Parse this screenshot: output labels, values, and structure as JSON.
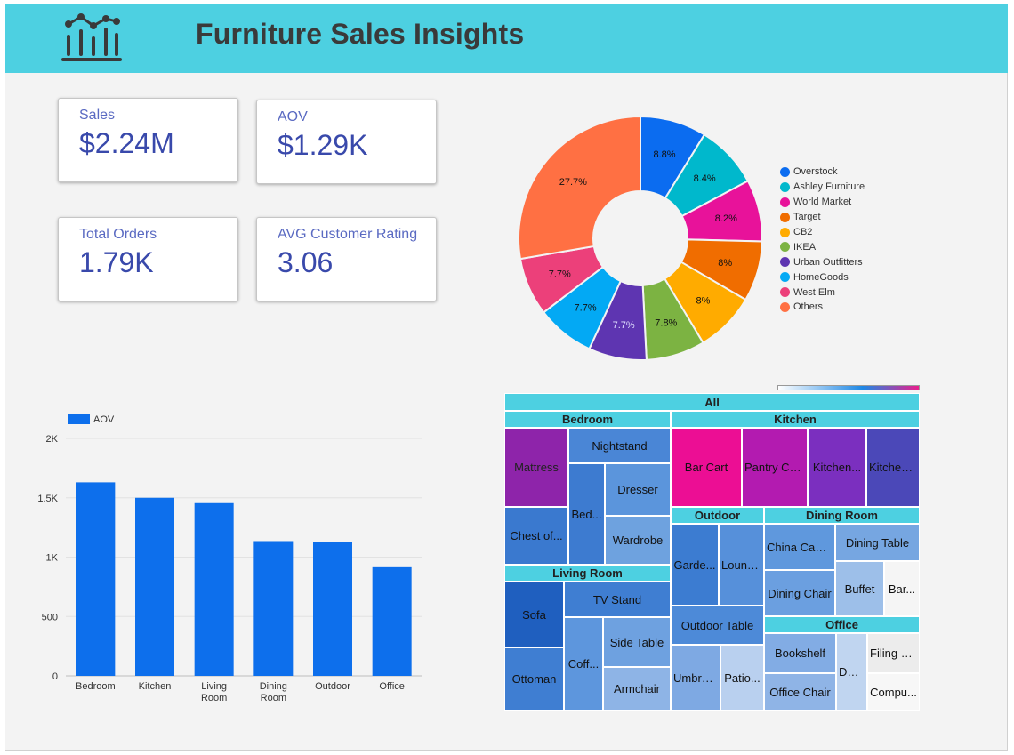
{
  "header": {
    "title": "Furniture Sales Insights",
    "logo_icon": "bar-chart-logo-icon"
  },
  "kpis": {
    "sales": {
      "label": "Sales",
      "value": "$2.24M"
    },
    "aov": {
      "label": "AOV",
      "value": "$1.29K"
    },
    "total_orders": {
      "label": "Total Orders",
      "value": "1.79K"
    },
    "avg_rating": {
      "label": "AVG Customer Rating",
      "value": "3.06"
    }
  },
  "chart_data": [
    {
      "type": "pie",
      "subtype": "donut",
      "legend_position": "right",
      "slices": [
        {
          "name": "Overstock",
          "value": 8.8,
          "label": "8.8%",
          "color": "#0b6cf0"
        },
        {
          "name": "Ashley Furniture",
          "value": 8.4,
          "label": "8.4%",
          "color": "#00b8cc"
        },
        {
          "name": "World Market",
          "value": 8.2,
          "label": "8.2%",
          "color": "#e8129a"
        },
        {
          "name": "Target",
          "value": 8.0,
          "label": "8%",
          "color": "#f06d00"
        },
        {
          "name": "CB2",
          "value": 8.0,
          "label": "8%",
          "color": "#ffab00"
        },
        {
          "name": "IKEA",
          "value": 7.8,
          "label": "7.8%",
          "color": "#7cb342"
        },
        {
          "name": "Urban Outfitters",
          "value": 7.7,
          "label": "7.7%",
          "color": "#5e35b1"
        },
        {
          "name": "HomeGoods",
          "value": 7.7,
          "label": "7.7%",
          "color": "#03a9f4"
        },
        {
          "name": "West Elm",
          "value": 7.7,
          "label": "7.7%",
          "color": "#ec407a"
        },
        {
          "name": "Others",
          "value": 27.7,
          "label": "27.7%",
          "color": "#ff7043"
        }
      ]
    },
    {
      "type": "bar",
      "legend_position": "top-left",
      "series": [
        {
          "name": "AOV",
          "color": "#0d6fec",
          "values": [
            1630,
            1500,
            1455,
            1135,
            1125,
            915
          ]
        }
      ],
      "categories": [
        "Bedroom",
        "Kitchen",
        "Living Room",
        "Dining Room",
        "Outdoor",
        "Office"
      ],
      "y_ticks": [
        "0",
        "500",
        "1K",
        "1.5K",
        "2K"
      ],
      "ylim": [
        0,
        2000
      ],
      "grid": true
    },
    {
      "type": "treemap",
      "root": "All",
      "groups": [
        {
          "name": "Bedroom",
          "items": [
            "Mattress",
            "Nightstand",
            "Bed...",
            "Dresser",
            "Chest of...",
            "Wardrobe"
          ]
        },
        {
          "name": "Kitchen",
          "items": [
            "Bar Cart",
            "Pantry Ca...",
            "Kitchen...",
            "Kitchen..."
          ]
        },
        {
          "name": "Outdoor",
          "items": [
            "Garde...",
            "Loung...",
            "Outdoor Table",
            "Umbrella",
            "Patio..."
          ]
        },
        {
          "name": "Dining Room",
          "items": [
            "China Cabi...",
            "Dining Table",
            "Dining Chair",
            "Buffet",
            "Bar..."
          ]
        },
        {
          "name": "Living Room",
          "items": [
            "Sofa",
            "TV Stand",
            "Coff...",
            "Side Table",
            "Ottoman",
            "Armchair"
          ]
        },
        {
          "name": "Office",
          "items": [
            "Bookshelf",
            "Desk",
            "Filing C...",
            "Office Chair",
            "Compu..."
          ]
        }
      ]
    }
  ]
}
